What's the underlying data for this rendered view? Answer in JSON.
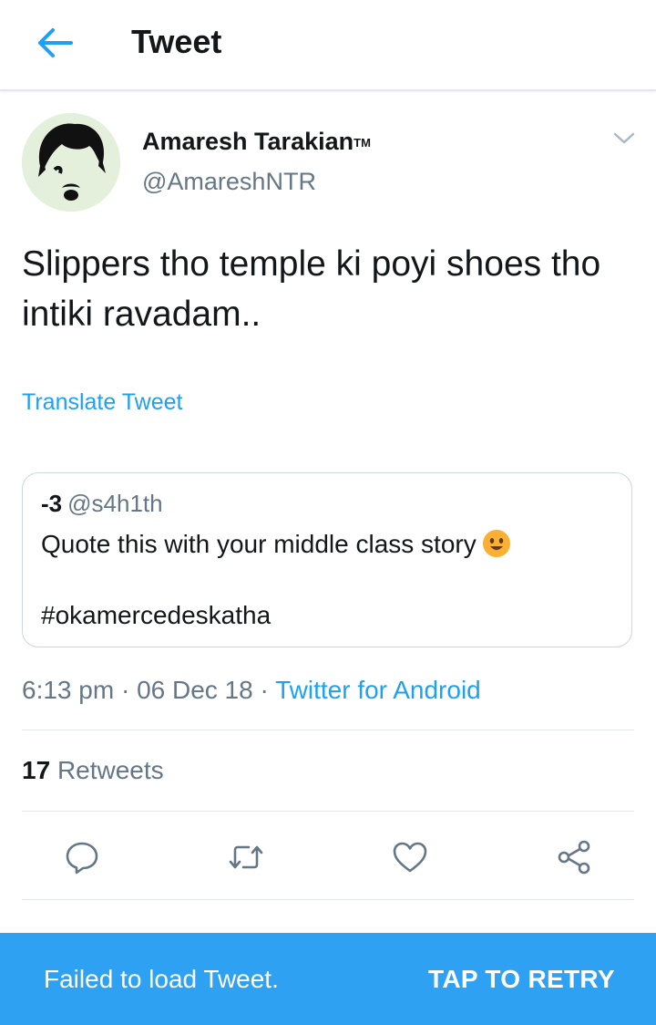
{
  "header": {
    "title": "Tweet",
    "back_icon": "arrow-left-icon"
  },
  "tweet": {
    "author": {
      "name": "Amaresh Tarakian",
      "trademark": "TM",
      "handle": "@AmareshNTR"
    },
    "text": "Slippers tho temple ki poyi shoes tho intiki ravadam..",
    "translate_label": "Translate Tweet",
    "quote": {
      "name": "-3",
      "handle": "@s4h1th",
      "line1": "Quote this with your middle class story",
      "line2": "#okamercedeskatha",
      "emoji": "smiling-face-emoji"
    },
    "meta": {
      "time": "6:13 pm",
      "separator": " · ",
      "date": "06 Dec 18",
      "source": "Twitter for Android"
    },
    "stats": {
      "retweet_count": "17",
      "retweet_label": "Retweets"
    },
    "actions": [
      "reply-icon",
      "retweet-icon",
      "like-icon",
      "share-icon"
    ]
  },
  "snackbar": {
    "message": "Failed to load Tweet.",
    "action": "TAP TO RETRY"
  },
  "colors": {
    "accent": "#1da1f2",
    "snackbar": "#2ea1f2",
    "muted": "#657786",
    "text": "#14171a"
  }
}
